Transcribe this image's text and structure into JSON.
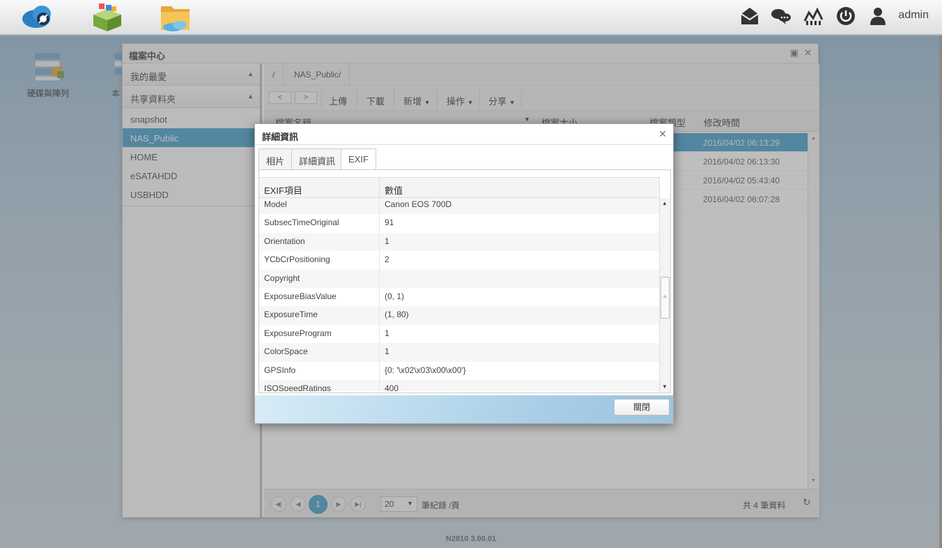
{
  "topbar": {
    "apps": [
      "cloud-app-icon",
      "package-app-icon",
      "file-folder-app-icon"
    ],
    "tray": [
      "mail-icon",
      "chat-icon",
      "network-icon",
      "power-icon",
      "user-icon"
    ],
    "user": "admin"
  },
  "desktop": {
    "icon_label": "硬碟與陣列",
    "icon2_label": "本"
  },
  "window": {
    "title": "檔案中心",
    "sidebar": {
      "favorites": "我的最愛",
      "shared": "共享資料夾",
      "items": [
        "snapshot",
        "NAS_Public",
        "HOME",
        "eSATAHDD",
        "USBHDD"
      ],
      "selected": "NAS_Public"
    },
    "breadcrumb": [
      "/",
      "NAS_Public/"
    ],
    "toolbar": {
      "upload": "上傳",
      "download": "下載",
      "add": "新增",
      "actions": "操作",
      "share": "分享"
    },
    "columns": [
      "檔案名稱",
      "檔案大小",
      "檔案類型",
      "修改時間"
    ],
    "rows": [
      {
        "modified": "2016/04/02 06:13:29"
      },
      {
        "modified": "2016/04/02 06:13:30"
      },
      {
        "modified": "2016/04/02 05:43:40"
      },
      {
        "modified": "2016/04/02 06:07:28"
      }
    ],
    "pager": {
      "current_page": "1",
      "page_size": "20",
      "page_size_label": "筆紀錄 /頁",
      "total": "共 4 筆資料"
    }
  },
  "dialog": {
    "title": "詳細資訊",
    "tabs": [
      "相片",
      "詳細資訊",
      "EXIF"
    ],
    "active_tab": "EXIF",
    "exif_header_key": "EXIF項目",
    "exif_header_value": "數值",
    "exif": [
      {
        "key": "Model",
        "value": "Canon EOS 700D"
      },
      {
        "key": "SubsecTimeOriginal",
        "value": "91"
      },
      {
        "key": "Orientation",
        "value": "1"
      },
      {
        "key": "YCbCrPositioning",
        "value": "2"
      },
      {
        "key": "Copyright",
        "value": ""
      },
      {
        "key": "ExposureBiasValue",
        "value": "(0, 1)"
      },
      {
        "key": "ExposureTime",
        "value": "(1, 80)"
      },
      {
        "key": "ExposureProgram",
        "value": "1"
      },
      {
        "key": "ColorSpace",
        "value": "1"
      },
      {
        "key": "GPSInfo",
        "value": "{0: '\\x02\\x03\\x00\\x00'}"
      },
      {
        "key": "ISOSpeedRatings",
        "value": "400"
      }
    ],
    "close_label": "關閉"
  },
  "version": "N2810   3.00.01"
}
